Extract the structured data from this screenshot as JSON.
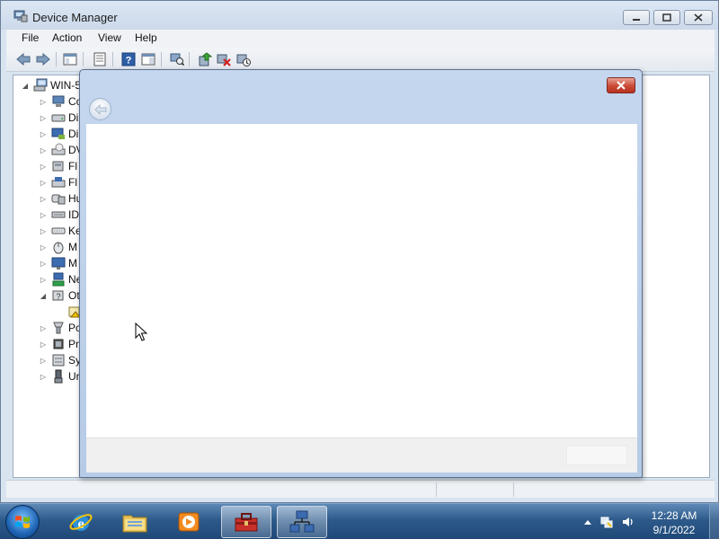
{
  "window": {
    "title": "Device Manager",
    "icon": "device-manager-icon"
  },
  "menu": [
    {
      "label": "File"
    },
    {
      "label": "Action"
    },
    {
      "label": "View"
    },
    {
      "label": "Help"
    }
  ],
  "toolbar": {
    "buttons": [
      "back-icon",
      "forward-icon",
      "show-hide-console-tree-icon",
      "properties-icon",
      "help-icon",
      "action-pane-icon",
      "scan-hardware-icon",
      "update-driver-icon",
      "uninstall-icon",
      "disable-device-icon"
    ]
  },
  "tree": {
    "root": "WIN-5",
    "items": [
      {
        "label": "Co",
        "icon": "computer-icon"
      },
      {
        "label": "Di",
        "icon": "disk-drive-icon"
      },
      {
        "label": "Di",
        "icon": "display-adapter-icon"
      },
      {
        "label": "DV",
        "icon": "dvd-drive-icon"
      },
      {
        "label": "Fl",
        "icon": "floppy-controller-icon"
      },
      {
        "label": "Fl",
        "icon": "floppy-drive-icon"
      },
      {
        "label": "Hu",
        "icon": "hid-icon"
      },
      {
        "label": "ID",
        "icon": "ide-controller-icon"
      },
      {
        "label": "Ke",
        "icon": "keyboard-icon"
      },
      {
        "label": "M",
        "icon": "mouse-icon"
      },
      {
        "label": "M",
        "icon": "monitor-icon"
      },
      {
        "label": "Ne",
        "icon": "network-adapter-icon"
      },
      {
        "label": "Ot",
        "icon": "other-devices-icon"
      },
      {
        "label": "",
        "icon": "unknown-device-icon"
      },
      {
        "label": "Po",
        "icon": "port-icon"
      },
      {
        "label": "Pr",
        "icon": "processor-icon"
      },
      {
        "label": "Sy",
        "icon": "system-device-icon"
      },
      {
        "label": "Ur",
        "icon": "usb-controller-icon"
      }
    ]
  },
  "dialog": {
    "close_icon": "close-icon",
    "back_icon": "back-arrow-icon"
  },
  "taskbar": {
    "apps": [
      "internet-explorer-icon",
      "windows-explorer-icon",
      "media-player-icon",
      "control-panel-icon",
      "device-manager-icon"
    ],
    "tray_icons": [
      "show-hidden-icons-icon",
      "network-icon",
      "volume-icon"
    ],
    "clock_time": "12:28 AM",
    "clock_date": "9/1/2022"
  },
  "colors": {
    "title_bar": "#cbd9ea",
    "dialog_frame": "#b6cbe6",
    "close_red": "#c94a36",
    "taskbar": "#2d5a8a"
  }
}
